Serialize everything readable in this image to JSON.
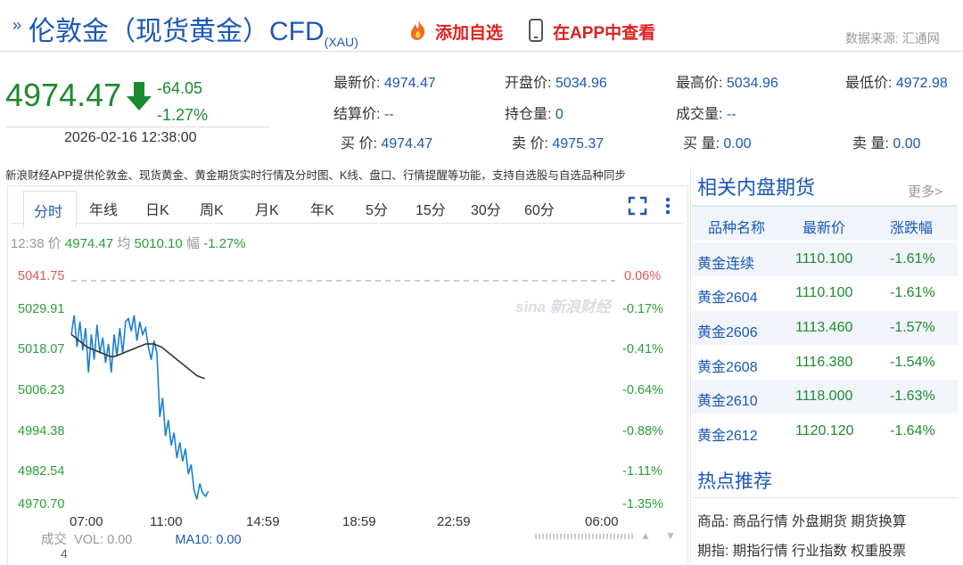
{
  "header": {
    "title": "伦敦金（现货黄金）CFD",
    "title_sub": "(XAU)",
    "add_fav": "添加自选",
    "open_app": "在APP中查看",
    "source": "数据来源: 汇通网"
  },
  "quote": {
    "price": "4974.47",
    "change": "-64.05",
    "change_pct": "-1.27%",
    "time": "2026-02-16 12:38:00"
  },
  "stats": [
    {
      "label": "最新价:",
      "value": "4974.47"
    },
    {
      "label": "开盘价:",
      "value": "5034.96"
    },
    {
      "label": "最高价:",
      "value": "5034.96"
    },
    {
      "label": "最低价:",
      "value": "4972.98"
    },
    {
      "label": "结算价:",
      "value": "--"
    },
    {
      "label": "持仓量:",
      "value": "0"
    },
    {
      "label": "成交量:",
      "value": "--"
    },
    {
      "label": "买  价:",
      "value": "4974.47"
    },
    {
      "label": "卖  价:",
      "value": "4975.37"
    },
    {
      "label": "买  量:",
      "value": "0.00"
    },
    {
      "label": "卖  量:",
      "value": "0.00"
    }
  ],
  "notice": "新浪财经APP提供伦敦金、现货黄金、黄金期货实时行情及分时图、K线、盘口、行情提醒等功能，支持自选股与自选品种同步",
  "tabs": [
    "分时",
    "年线",
    "日K",
    "周K",
    "月K",
    "年K",
    "5分",
    "15分",
    "30分",
    "60分"
  ],
  "chart_info": {
    "time": "12:38",
    "p_label": "价",
    "price": "4974.47",
    "avg_label": "均",
    "avg": "5010.10",
    "amp_label": "幅",
    "amp": "-1.27%"
  },
  "chart_data": {
    "type": "line",
    "y_labels": [
      "5041.75",
      "5029.91",
      "5018.07",
      "5006.23",
      "4994.38",
      "4982.54",
      "4970.70"
    ],
    "y_pct": [
      "0.06%",
      "-0.17%",
      "-0.41%",
      "-0.64%",
      "-0.88%",
      "-1.11%",
      "-1.35%"
    ],
    "ylim": [
      4970.7,
      5041.75
    ],
    "x_labels": [
      "07:00",
      "11:00",
      "14:59",
      "18:59",
      "22:59",
      "06:00"
    ],
    "series": [
      {
        "values": [
          5024,
          5030,
          5020,
          5028,
          5019,
          5026,
          5012,
          5024,
          5016,
          5027,
          5018,
          5023,
          5015,
          5021,
          5012,
          5024,
          5017,
          5026,
          5018,
          5028,
          5029,
          5025,
          5030,
          5022,
          5028,
          5024,
          5026,
          5020,
          5016,
          5022,
          5018,
          4998,
          5004,
          4992,
          4997,
          4989,
          4993,
          4985,
          4990,
          4984,
          4988,
          4980,
          4983,
          4975,
          4972,
          4977,
          4974,
          4972.98,
          4974.47
        ]
      },
      {
        "values": [
          5024,
          5023,
          5022,
          5021,
          5020,
          5019.5,
          5019,
          5018.5,
          5018,
          5017.5,
          5017,
          5017,
          5017.5,
          5018,
          5018.5,
          5019,
          5019.5,
          5020,
          5020.5,
          5021,
          5021,
          5021,
          5020.5,
          5020,
          5019,
          5018,
          5017,
          5016,
          5015,
          5014,
          5013,
          5012,
          5011,
          5010.5,
          5010.1
        ]
      }
    ]
  },
  "volume": {
    "label": "成交",
    "vol": "VOL: 0.00",
    "ma": "MA10: 0.00",
    "extra": "4"
  },
  "related": {
    "title": "相关内盘期货",
    "more": "更多>",
    "headers": [
      "品种名称",
      "最新价",
      "涨跌幅"
    ],
    "rows": [
      [
        "黄金连续",
        "1110.100",
        "-1.61%"
      ],
      [
        "黄金2604",
        "1110.100",
        "-1.61%"
      ],
      [
        "黄金2606",
        "1113.460",
        "-1.57%"
      ],
      [
        "黄金2608",
        "1116.380",
        "-1.54%"
      ],
      [
        "黄金2610",
        "1118.000",
        "-1.63%"
      ],
      [
        "黄金2612",
        "1120.120",
        "-1.64%"
      ]
    ]
  },
  "hot": {
    "title": "热点推荐",
    "lines": [
      "商品: 商品行情 外盘期货 期货换算",
      "期指: 期指行情 行业指数 权重股票"
    ]
  },
  "colors": {
    "up_green": "#1c8a2e",
    "link_blue": "#1a58b8",
    "accent_red": "#e02020",
    "avg_line": "#333333",
    "price_line": "#1b7fd1"
  }
}
